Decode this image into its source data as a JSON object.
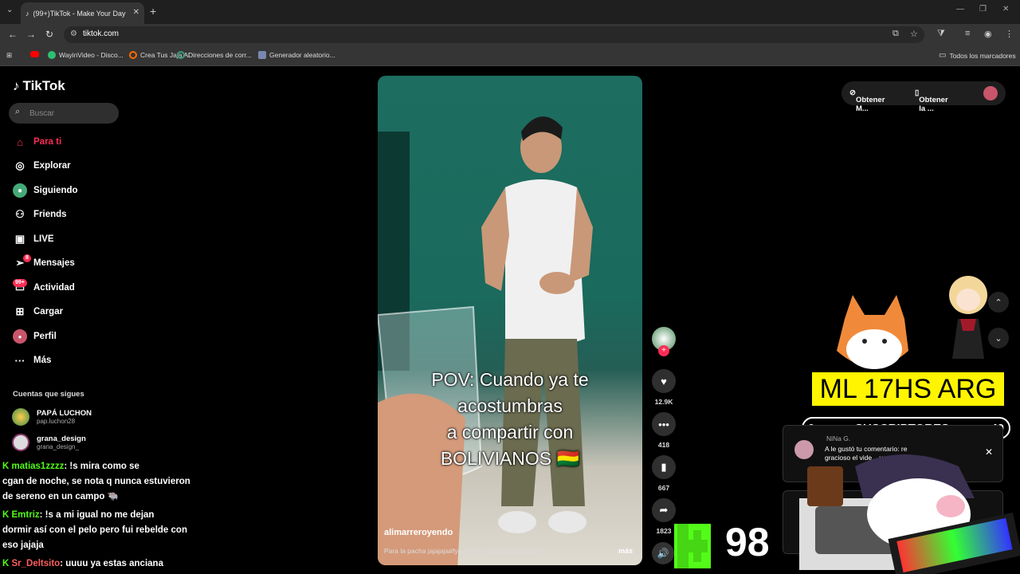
{
  "browser": {
    "tab_title": "(99+)TikTok - Make Your Day",
    "url": "tiktok.com",
    "bookmarks": [
      "WayinVideo - Disco...",
      "Crea Tus Jaja AI",
      "Direcciones de corr...",
      "Generador aleatorio..."
    ],
    "bookmarks_all": "Todos los marcadores"
  },
  "tiktok": {
    "logo": "TikTok",
    "search_placeholder": "Buscar",
    "nav": [
      {
        "label": "Para ti",
        "icon": "home-icon"
      },
      {
        "label": "Explorar",
        "icon": "compass-icon"
      },
      {
        "label": "Siguiendo",
        "icon": "following-icon"
      },
      {
        "label": "Friends",
        "icon": "friends-icon"
      },
      {
        "label": "LIVE",
        "icon": "live-icon"
      },
      {
        "label": "Mensajes",
        "icon": "message-icon",
        "badge": "8"
      },
      {
        "label": "Actividad",
        "icon": "activity-icon",
        "badge": "99+"
      },
      {
        "label": "Cargar",
        "icon": "upload-icon"
      },
      {
        "label": "Perfil",
        "icon": "profile-icon"
      },
      {
        "label": "Más",
        "icon": "more-icon"
      }
    ],
    "following_title": "Cuentas que sigues",
    "accounts": [
      {
        "name": "PAPÁ LUCHON",
        "handle": "pap.luchon28"
      },
      {
        "name": "grana_design",
        "handle": "grana_design_"
      }
    ],
    "video": {
      "caption": [
        "POV: Cuando ya te",
        "acostumbras",
        "a compartir con",
        "BOLIVIANOS 🇧🇴"
      ],
      "user": "alimarreroyendo",
      "description": "Para la pacha jajajaja#fyp #foryou #paratiiiiiiiiiiiiiiiiiiiiiii ...",
      "more": "más"
    },
    "actions": {
      "likes": "12.9K",
      "comments": "418",
      "saves": "667",
      "shares": "1823"
    },
    "top_right": {
      "btn1": "Obtener M...",
      "btn2": "Obtener la ..."
    }
  },
  "chat": [
    {
      "user": "matias1zzzz",
      "text": ": !s mira como se"
    },
    {
      "user": "",
      "text": "cgan de noche, se nota q nunca estuvieron"
    },
    {
      "user": "",
      "text": "de sereno en un campo 🐃"
    },
    {
      "user": "Emtriz",
      "text": ": !s a mi igual no me dejan"
    },
    {
      "user": "",
      "text": "dormir así con el pelo pero fui rebelde con"
    },
    {
      "user": "",
      "text": "eso jajaja"
    },
    {
      "user": "Sr_Deltsito",
      "text": ": uuuu ya estas anciana"
    }
  ],
  "overlay": {
    "banner": "ML 17HS ARG",
    "subs_left": "0",
    "subs_label": "SUSCRIPTORES",
    "subs_right": "40",
    "notif_user": "NiNa G.",
    "notif_text": "A le gustó tu comentario: re gracioso el vide... vas a ...",
    "kick_count": "98"
  },
  "colors": {
    "accent": "#fe2c55",
    "kick_green": "#53fc18",
    "banner_yellow": "#fff500"
  }
}
